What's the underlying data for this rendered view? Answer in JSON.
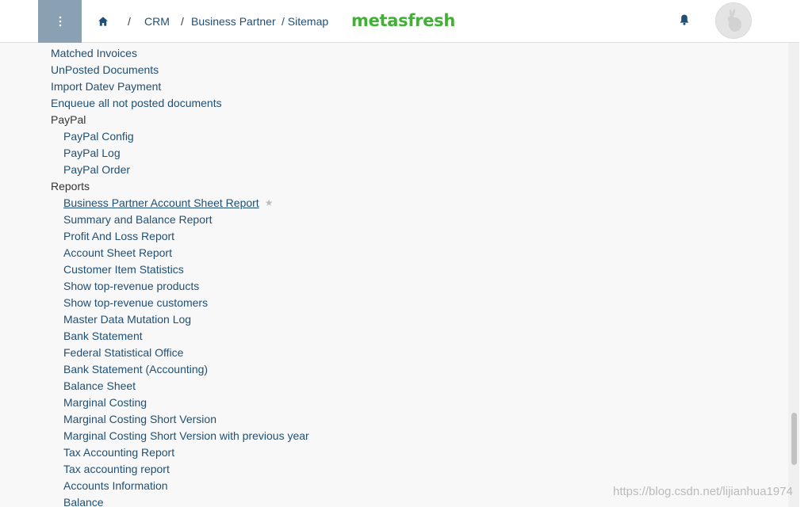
{
  "header": {
    "menu_icon": "vertical-dots-icon",
    "home_icon": "home-icon",
    "breadcrumb": {
      "sep1": "/",
      "crumb1": "CRM",
      "sep2": "/",
      "crumb2": "Business Partner",
      "crumb3": "/ Sitemap"
    },
    "logo": {
      "part1": "meta",
      "part2": "sfresh",
      "color1": "#3fb133",
      "color2": "#3fb133"
    },
    "bell_icon": "bell-icon",
    "avatar_icon": "user-avatar-icon",
    "accent": "#8aa1b4",
    "link_color": "#1f4f74"
  },
  "sitemap": {
    "items": [
      {
        "label": "Matched Invoices",
        "type": "link"
      },
      {
        "label": "UnPosted Documents",
        "type": "link"
      },
      {
        "label": "Import Datev Payment",
        "type": "link"
      },
      {
        "label": "Enqueue all not posted documents",
        "type": "link"
      },
      {
        "label": "PayPal",
        "type": "group"
      },
      {
        "label": "PayPal Config",
        "type": "link"
      },
      {
        "label": "PayPal Log",
        "type": "link"
      },
      {
        "label": "PayPal Order",
        "type": "link"
      },
      {
        "label": "Reports",
        "type": "group"
      },
      {
        "label": "Business Partner Account Sheet Report",
        "type": "link",
        "hovered": true,
        "star_icon": "star-icon"
      },
      {
        "label": "Summary and Balance Report",
        "type": "link"
      },
      {
        "label": "Profit And Loss Report",
        "type": "link"
      },
      {
        "label": "Account Sheet Report",
        "type": "link"
      },
      {
        "label": "Customer Item Statistics",
        "type": "link"
      },
      {
        "label": "Show top-revenue products",
        "type": "link"
      },
      {
        "label": "Show top-revenue customers",
        "type": "link"
      },
      {
        "label": "Master Data Mutation Log",
        "type": "link"
      },
      {
        "label": "Bank Statement",
        "type": "link"
      },
      {
        "label": "Federal Statistical Office",
        "type": "link"
      },
      {
        "label": "Bank Statement (Accounting)",
        "type": "link"
      },
      {
        "label": "Balance Sheet",
        "type": "link"
      },
      {
        "label": "Marginal Costing",
        "type": "link"
      },
      {
        "label": "Marginal Costing Short Version",
        "type": "link"
      },
      {
        "label": "Marginal Costing Short Version with previous year",
        "type": "link"
      },
      {
        "label": "Tax Accounting Report",
        "type": "link"
      },
      {
        "label": "Tax accounting report",
        "type": "link"
      },
      {
        "label": "Accounts Information",
        "type": "link"
      },
      {
        "label": "Balance",
        "type": "link"
      }
    ]
  },
  "watermark": "https://blog.csdn.net/lijianhua1974"
}
